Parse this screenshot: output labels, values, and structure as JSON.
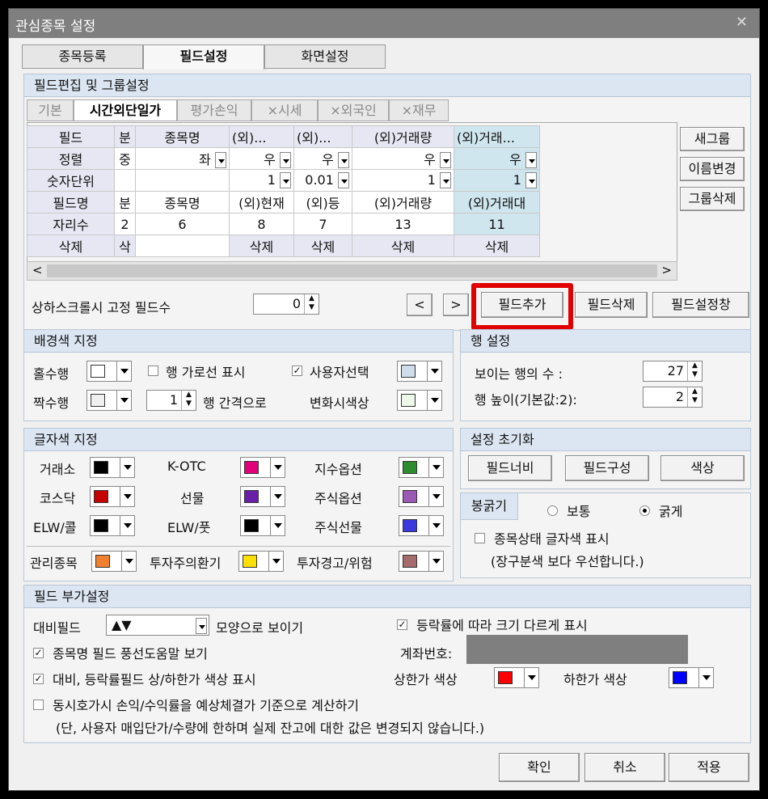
{
  "window": {
    "title": "관심종목 설정",
    "close": "✕"
  },
  "tabs": [
    "종목등록",
    "필드설정",
    "화면설정"
  ],
  "field_edit": {
    "title": "필드편집 및 그룹설정",
    "subtabs": [
      "기본",
      "시간외단일가",
      "평가손익",
      "×시세",
      "×외국인",
      "×재무"
    ],
    "rows": {
      "r1": [
        "필드",
        "분",
        "종목명",
        "(외)...",
        "(외)...",
        "(외)거래량",
        "(외)거래..."
      ],
      "r2": [
        "정렬",
        "중",
        "좌",
        "우",
        "우",
        "우",
        "우"
      ],
      "r3": [
        "숫자단위",
        "",
        "",
        "1",
        "0.01",
        "1",
        "1"
      ],
      "r4": [
        "필드명",
        "분",
        "종목명",
        "(외)현재",
        "(외)등",
        "(외)거래량",
        "(외)거래대"
      ],
      "r5": [
        "자리수",
        "2",
        "6",
        "8",
        "7",
        "13",
        "11"
      ],
      "r6": [
        "삭제",
        "삭",
        "",
        "삭제",
        "삭제",
        "삭제",
        "삭제"
      ]
    },
    "side_buttons": [
      "새그룹",
      "이름변경",
      "그룹삭제"
    ],
    "fixed_label": "상하스크롤시 고정 필드수",
    "fixed_value": "0",
    "nav_prev": "<",
    "nav_next": ">",
    "add": "필드추가",
    "del": "필드삭제",
    "window": "필드설정창",
    "scroll_left": "<",
    "scroll_right": ">"
  },
  "bg_color": {
    "title": "배경색 지정",
    "odd": "홀수행",
    "even": "짝수행",
    "hline": "행 가로선 표시",
    "interval_value": "1",
    "interval_label": "행 간격으로",
    "user_select": "사용자선택",
    "change_color": "변화시색상",
    "colors": {
      "odd": "#ffffff",
      "even": "#f0f0f0",
      "user": "#cfdcec",
      "change": "#eef8e8"
    }
  },
  "row_settings": {
    "title": "행 설정",
    "visible_label": "보이는 행의 수 :",
    "visible_value": "27",
    "height_label": "행 높이(기본값:2):",
    "height_value": "2"
  },
  "text_color": {
    "title": "글자색 지정",
    "items": [
      {
        "label": "거래소",
        "color": "#000000"
      },
      {
        "label": "K-OTC",
        "color": "#e0007a"
      },
      {
        "label": "지수옵션",
        "color": "#2e8b2e"
      },
      {
        "label": "코스닥",
        "color": "#c40000"
      },
      {
        "label": "선물",
        "color": "#6a1fa8"
      },
      {
        "label": "주식옵션",
        "color": "#9b59b6"
      },
      {
        "label": "ELW/콜",
        "color": "#000000"
      },
      {
        "label": "ELW/풋",
        "color": "#000000"
      },
      {
        "label": "주식선물",
        "color": "#3a3adf"
      }
    ],
    "extra": [
      {
        "label": "관리종목",
        "color": "#f08030"
      },
      {
        "label": "투자주의환기",
        "color": "#ffe000"
      },
      {
        "label": "투자경고/위험",
        "color": "#a66b6b"
      }
    ]
  },
  "reset": {
    "title": "설정 초기화",
    "b1": "필드너비",
    "b2": "필드구성",
    "b3": "색상"
  },
  "bold": {
    "title": "봉굵기",
    "normal": "보통",
    "thick": "굵게",
    "status_label": "종목상태 글자색 표시",
    "status_note": "(장구분색 보다 우선합니다.)"
  },
  "extra": {
    "title": "필드 부가설정",
    "compare_label": "대비필드",
    "compare_value": "▲▼",
    "compare_suffix": "모양으로 보이기",
    "tooltip": "종목명 필드 풍선도움말 보기",
    "limit_color": "대비, 등락률필드 상/하한가 색상 표시",
    "sim_calc": "동시호가시 손익/수익률을 예상체결가 기준으로 계산하기",
    "sim_note": "(단, 사용자 매입단가/수량에 한하며 실제 잔고에 대한 값은 변경되지 않습니다.)",
    "size_by_rate": "등락률에 따라 크기 다르게 표시",
    "account_label": "계좌번호:",
    "upper_label": "상한가 색상",
    "lower_label": "하한가 색상",
    "upper_color": "#ff0000",
    "lower_color": "#0000ff"
  },
  "footer": {
    "ok": "확인",
    "cancel": "취소",
    "apply": "적용"
  }
}
